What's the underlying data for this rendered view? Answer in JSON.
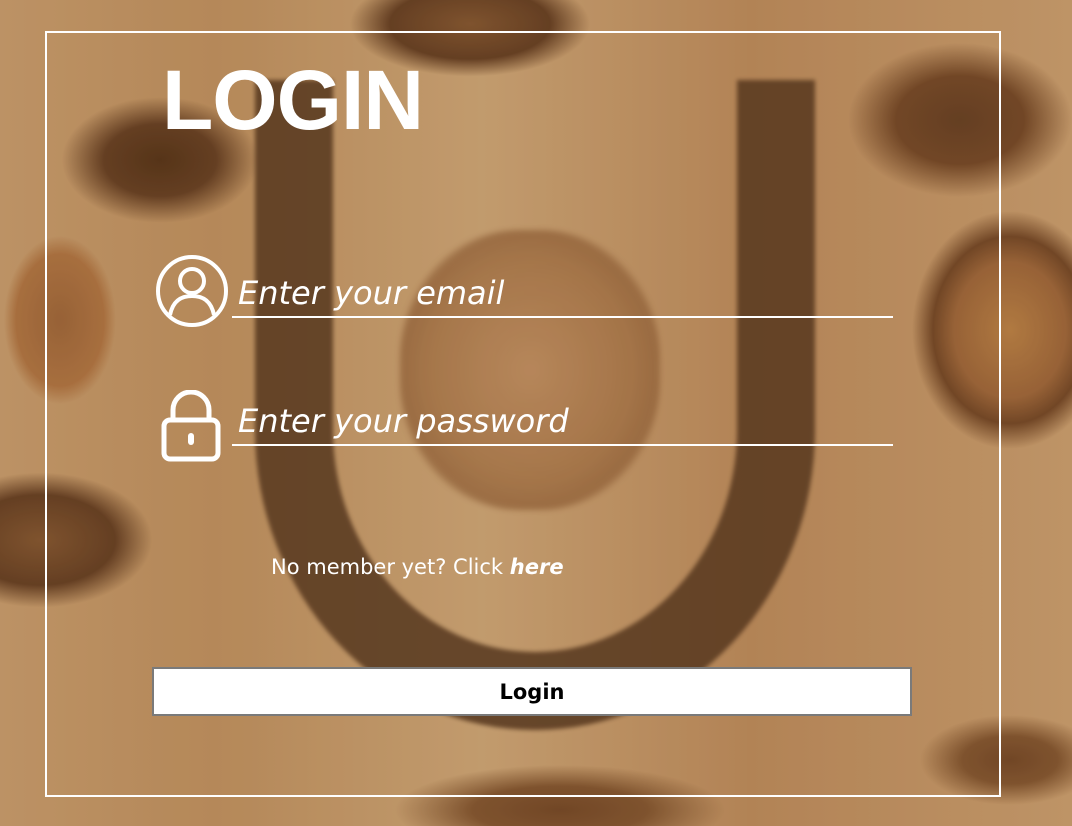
{
  "login": {
    "title": "LOGIN",
    "email": {
      "placeholder": "Enter your email",
      "value": "",
      "icon": "user-icon"
    },
    "password": {
      "placeholder": "Enter your password",
      "value": "",
      "icon": "lock-icon"
    },
    "signup_prompt": "No member yet? Click",
    "signup_link": "here",
    "submit_label": "Login"
  },
  "colors": {
    "foreground": "#ffffff",
    "button_background": "#ffffff",
    "button_text": "#000000",
    "button_border": "#7a7a7a",
    "background_tone": "#c99864"
  }
}
